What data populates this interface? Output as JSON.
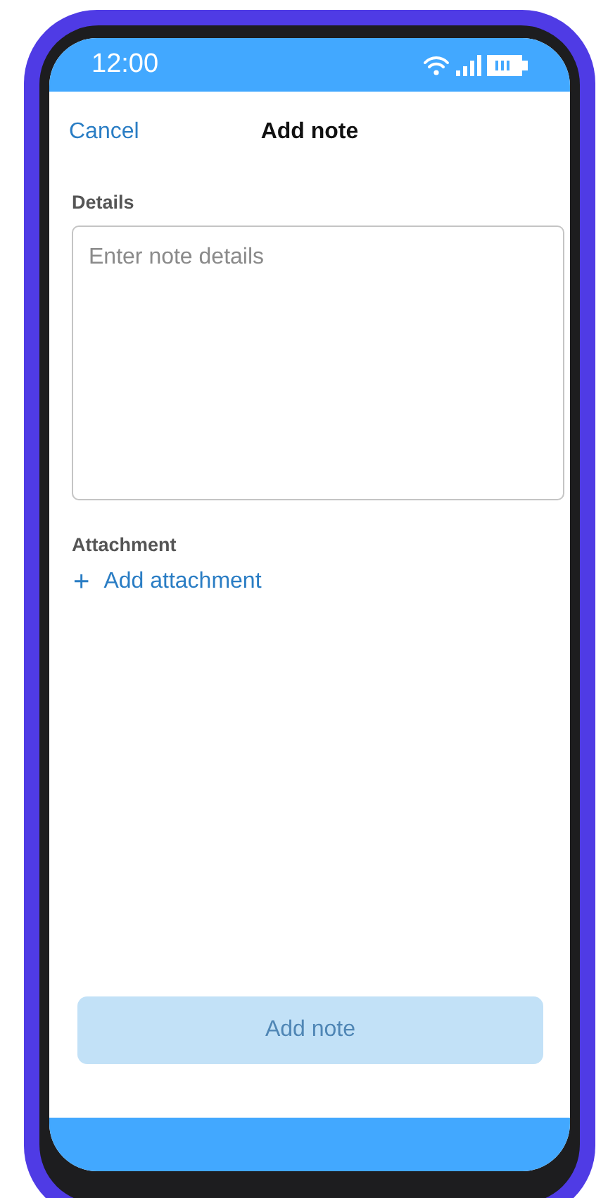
{
  "status_bar": {
    "time": "12:00"
  },
  "header": {
    "cancel": "Cancel",
    "title": "Add note"
  },
  "details": {
    "label": "Details",
    "placeholder": "Enter note details"
  },
  "attachment": {
    "label": "Attachment",
    "icon": "+",
    "action": "Add attachment"
  },
  "submit": {
    "label": "Add note",
    "disabled": true
  }
}
